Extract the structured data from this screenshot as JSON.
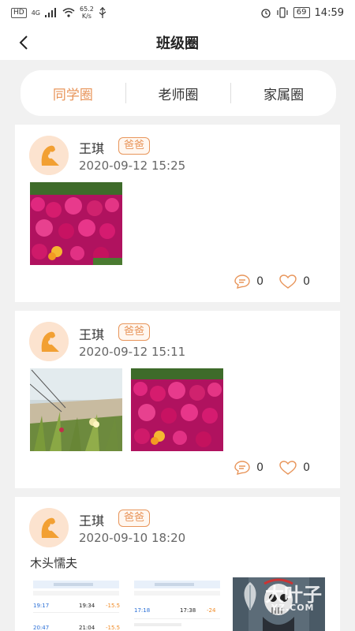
{
  "status_bar": {
    "network_tags": [
      "HD",
      "4G"
    ],
    "speed_value": "65.2",
    "speed_unit": "K/s",
    "battery": "69",
    "time": "14:59"
  },
  "nav": {
    "title": "班级圈",
    "back_icon": "chevron-left-icon"
  },
  "tabs": [
    {
      "label": "同学圈",
      "active": true
    },
    {
      "label": "老师圈",
      "active": false
    },
    {
      "label": "家属圈",
      "active": false
    }
  ],
  "posts": [
    {
      "author": "王琪",
      "role": "爸爸",
      "time": "2020-09-12 15:25",
      "text": "",
      "photo_count": 1,
      "comments": "0",
      "likes": "0"
    },
    {
      "author": "王琪",
      "role": "爸爸",
      "time": "2020-09-12 15:11",
      "text": "",
      "photo_count": 2,
      "comments": "0",
      "likes": "0"
    },
    {
      "author": "王琪",
      "role": "爸爸",
      "time": "2020-09-10 18:20",
      "text": "木头懦夫",
      "photo_count": 3
    }
  ],
  "screenshot_text": {
    "t1": "19:17",
    "t2": "19:34",
    "t3": "17:18",
    "t4": "17:38",
    "t5": "20:47",
    "t6": "21:04",
    "d1": "-15.5",
    "d2": "-24",
    "d3": "-15.5"
  },
  "watermark": {
    "main": "大叶子",
    "sub": "YZ.COM"
  },
  "colors": {
    "accent": "#e8955a",
    "background": "#f1f1f1",
    "card": "#ffffff"
  }
}
